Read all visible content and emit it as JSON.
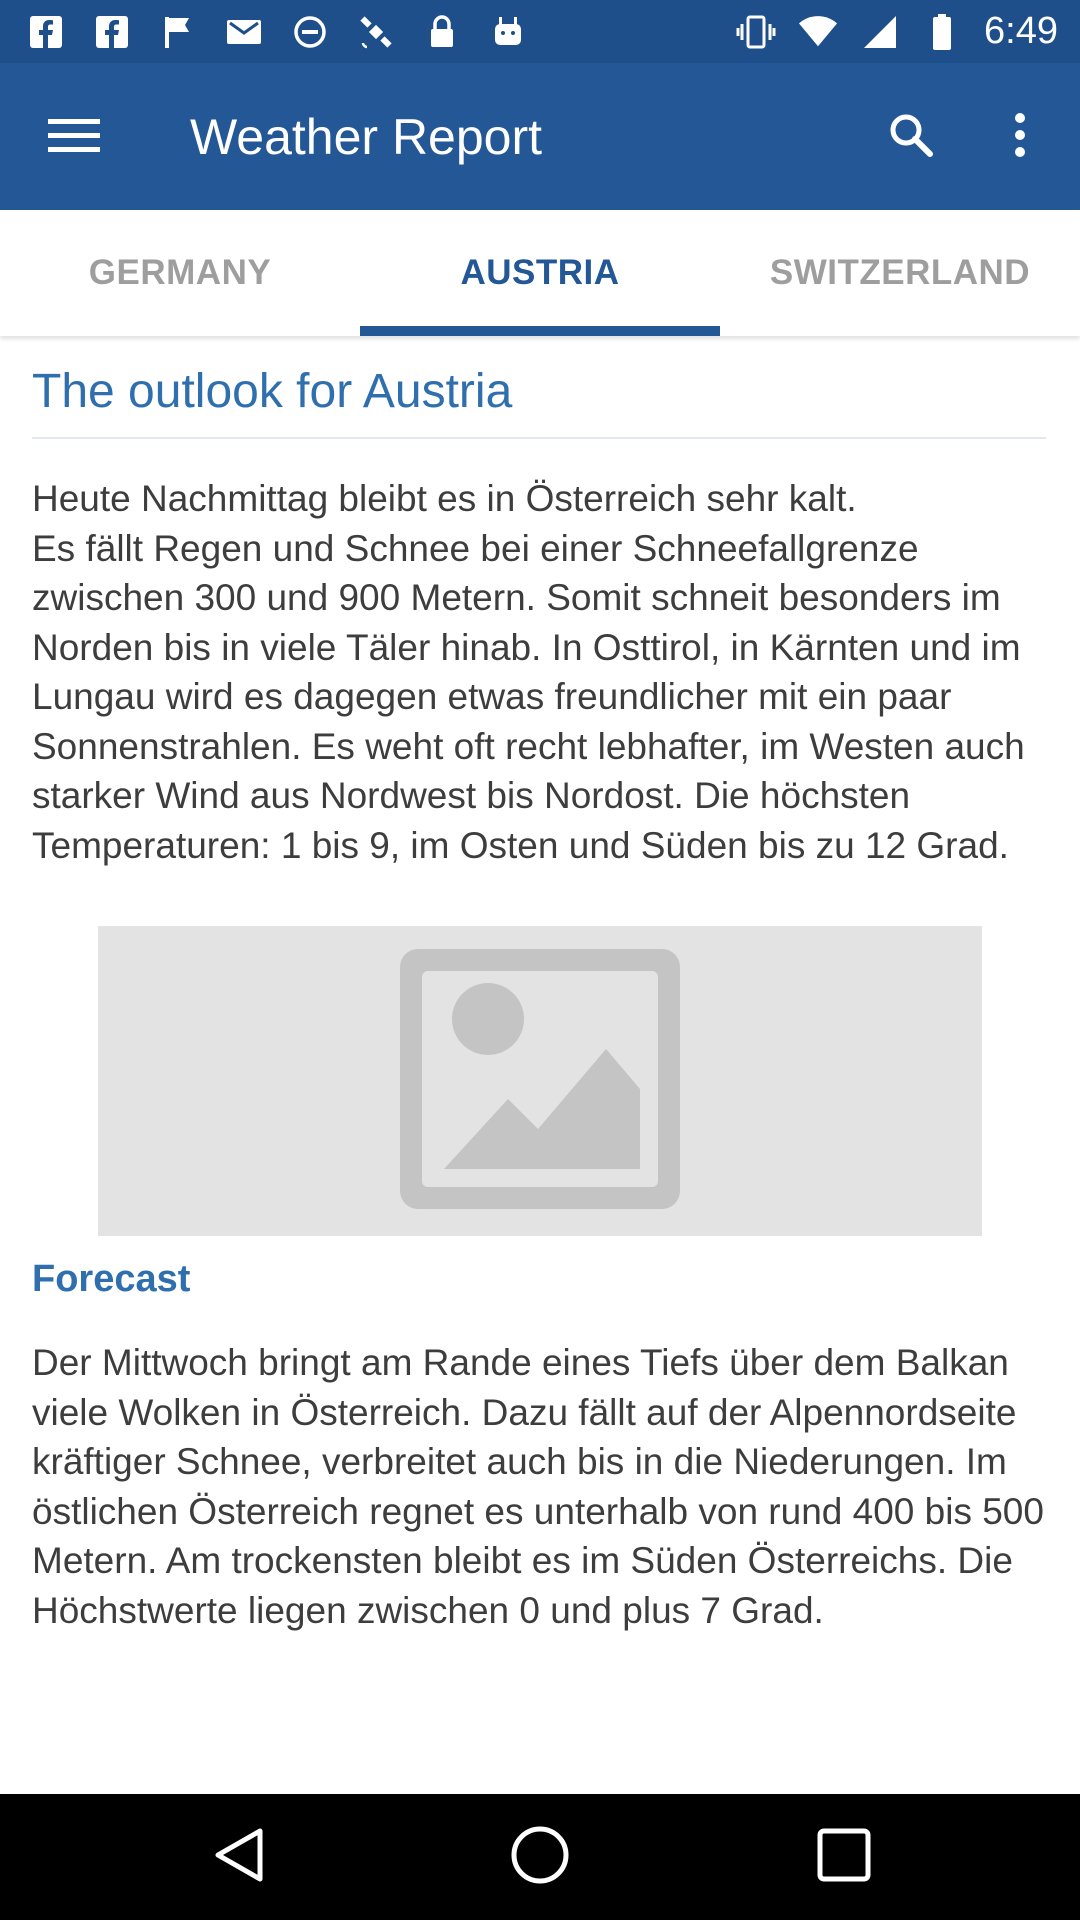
{
  "status_bar": {
    "time": "6:49",
    "icons_left": [
      "facebook-icon",
      "facebook-icon",
      "flag-icon",
      "mail-icon",
      "blocked-icon",
      "satellite-icon",
      "lock-icon",
      "android-icon"
    ],
    "icons_right": [
      "vibrate-icon",
      "wifi-icon",
      "signal-icon",
      "battery-icon"
    ],
    "background_color": "#1e4f8b"
  },
  "app_bar": {
    "title": "Weather Report",
    "background_color": "#245795"
  },
  "tabs": [
    {
      "label": "GERMANY",
      "selected": false
    },
    {
      "label": "AUSTRIA",
      "selected": true
    },
    {
      "label": "SWITZERLAND",
      "selected": false
    }
  ],
  "content": {
    "heading": "The outlook for Austria",
    "paragraph1": "Heute Nachmittag bleibt es in Österreich sehr kalt.\nEs fällt Regen und Schnee bei einer Schneefallgrenze zwischen 300 und 900 Metern. Somit schneit besonders im Norden bis in viele Täler hinab. In Osttirol, in Kärnten und im Lungau wird es dagegen etwas freundlicher mit ein paar Sonnenstrahlen. Es weht oft recht lebhafter, im Westen auch starker Wind aus Nordwest bis Nordost. Die höchsten Temperaturen: 1 bis 9, im Osten und Süden bis zu 12 Grad.",
    "image": "image-placeholder-icon",
    "forecast_heading": "Forecast",
    "paragraph2": "Der Mittwoch bringt am Rande eines Tiefs über dem Balkan viele Wolken in Österreich. Dazu fällt auf der Alpennordseite kräftiger Schnee, verbreitet auch bis in die Niederungen. Im östlichen Österreich regnet es unterhalb von rund 400 bis 500 Metern. Am trockensten bleibt es im Süden Österreichs. Die Höchstwerte liegen zwischen 0 und plus 7 Grad."
  },
  "colors": {
    "accent": "#2f6fae",
    "tab_inactive": "#9e9e9e"
  }
}
